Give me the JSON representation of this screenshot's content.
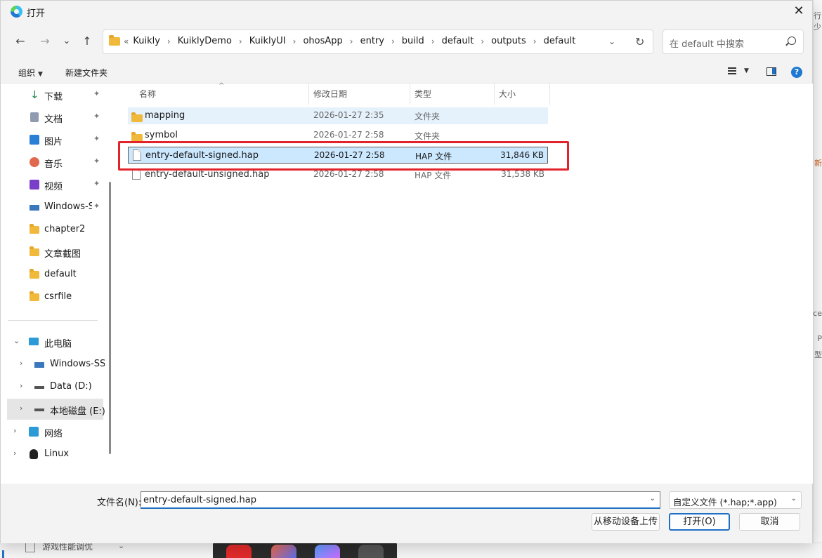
{
  "dialog": {
    "title": "打开",
    "close_glyph": "✕"
  },
  "nav": {
    "back_glyph": "←",
    "forward_glyph": "→",
    "recent_glyph": "⌄",
    "up_glyph": "↑",
    "overflow_glyph": "«",
    "breadcrumbs": [
      "Kuikly",
      "KuiklyDemo",
      "KuiklyUI",
      "ohosApp",
      "entry",
      "build",
      "default",
      "outputs",
      "default"
    ],
    "separator_glyph": "›",
    "dropdown_glyph": "⌄",
    "refresh_glyph": "↻",
    "search_placeholder": "在 default 中搜索"
  },
  "command_bar": {
    "organize_label": "组织",
    "organize_caret": "▼",
    "new_folder_label": "新建文件夹",
    "view_caret": "▼",
    "help_glyph": "?"
  },
  "sidebar": {
    "pin_glyph": "📌",
    "expand_glyph": "›",
    "collapse_glyph": "⌄",
    "quick_access": [
      {
        "label": "下载",
        "icon": "download-icon"
      },
      {
        "label": "文档",
        "icon": "documents-icon"
      },
      {
        "label": "图片",
        "icon": "pictures-icon"
      },
      {
        "label": "音乐",
        "icon": "music-icon"
      },
      {
        "label": "视频",
        "icon": "videos-icon"
      },
      {
        "label": "Windows-SSD",
        "icon": "drive-icon"
      },
      {
        "label": "chapter2",
        "icon": "folder-icon"
      },
      {
        "label": "文章截图",
        "icon": "folder-icon"
      },
      {
        "label": "default",
        "icon": "folder-icon"
      },
      {
        "label": "csrfile",
        "icon": "folder-icon"
      }
    ],
    "tree": [
      {
        "label": "此电脑",
        "icon": "computer-icon"
      },
      {
        "label": "Windows-SSD (C:)",
        "icon": "drive-icon"
      },
      {
        "label": "Data (D:)",
        "icon": "drive-icon"
      },
      {
        "label": "本地磁盘 (E:)",
        "icon": "drive-icon"
      },
      {
        "label": "网络",
        "icon": "network-icon"
      },
      {
        "label": "Linux",
        "icon": "linux-icon"
      }
    ]
  },
  "file_list": {
    "columns": {
      "name": "名称",
      "date": "修改日期",
      "type": "类型",
      "size": "大小"
    },
    "sort_glyph": "^",
    "rows": [
      {
        "name": "mapping",
        "date": "2026-01-27 2:35",
        "type": "文件夹",
        "size": ""
      },
      {
        "name": "symbol",
        "date": "2026-01-27 2:58",
        "type": "文件夹",
        "size": ""
      },
      {
        "name": "entry-default-signed.hap",
        "date": "2026-01-27 2:58",
        "type": "HAP 文件",
        "size": "31,846 KB"
      },
      {
        "name": "entry-default-unsigned.hap",
        "date": "2026-01-27 2:58",
        "type": "HAP 文件",
        "size": "31,538 KB"
      }
    ]
  },
  "bottom": {
    "filename_label": "文件名(N):",
    "filename_value": "entry-default-signed.hap",
    "filter_value": "自定义文件 (*.hap;*.app)",
    "dropdown_glyph": "⌄",
    "upload_label": "从移动设备上传",
    "open_label": "打开(O)",
    "cancel_label": "取消"
  },
  "background": {
    "right_fragments": [
      "行少",
      "新",
      "ce",
      "P",
      "型"
    ],
    "perf_label": "游戏性能调优",
    "perf_caret": "⌄"
  },
  "colors": {
    "accent": "#1f6fc5",
    "selection": "#cce8ff",
    "highlight_border": "#e2232a",
    "folder": "#f0b93b"
  }
}
